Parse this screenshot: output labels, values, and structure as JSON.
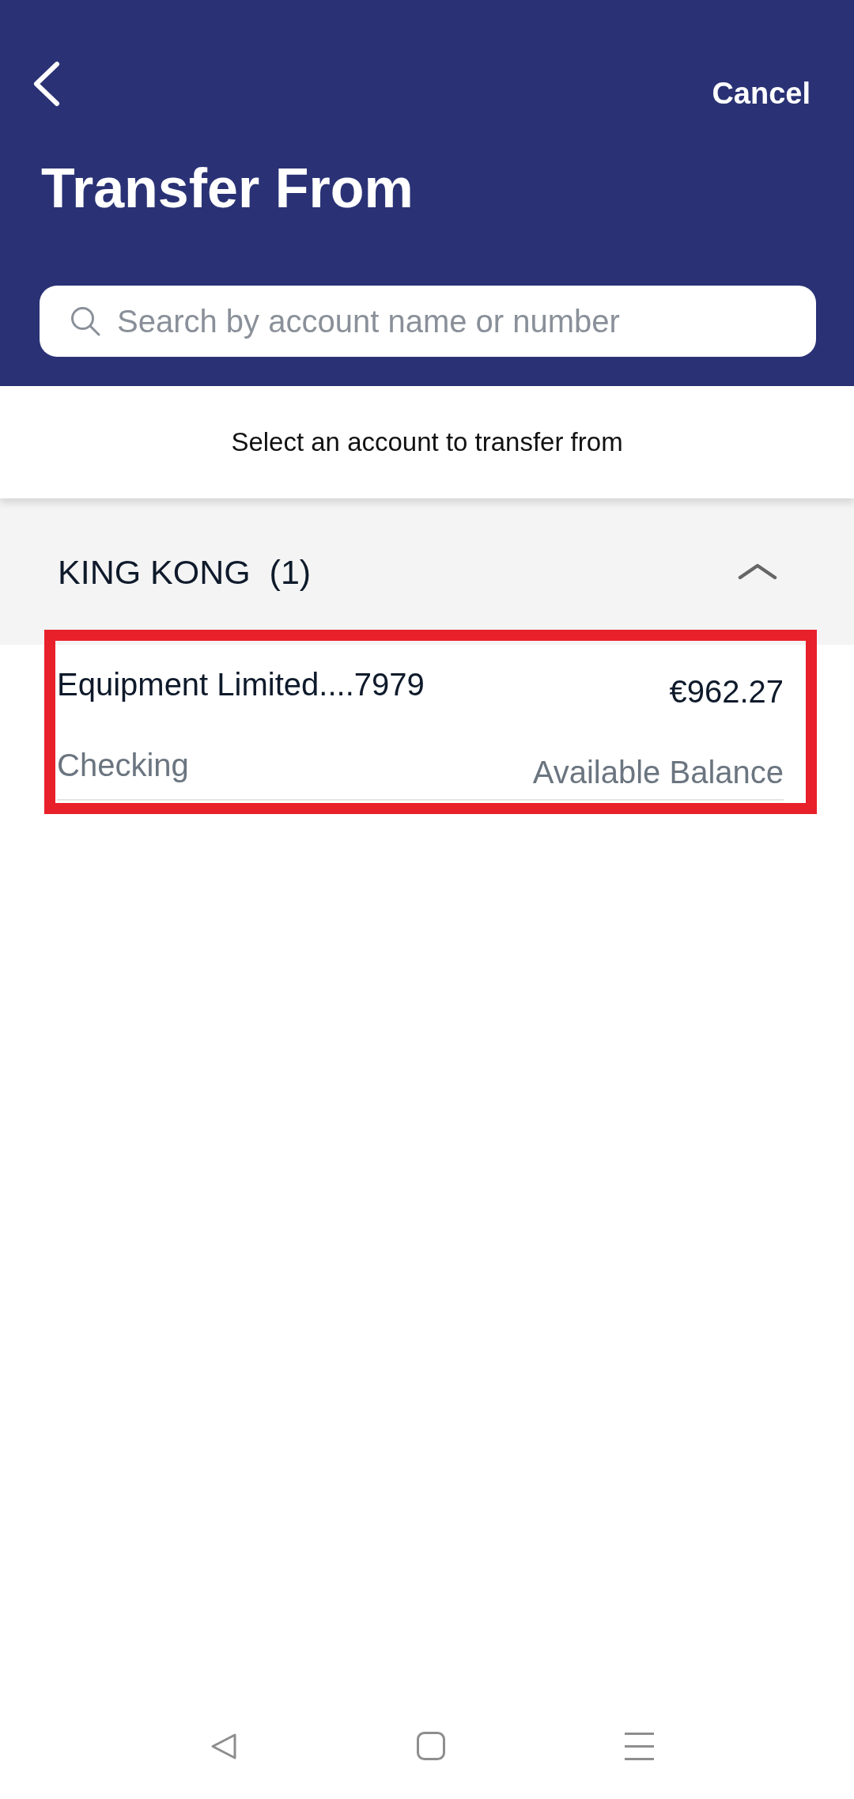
{
  "header": {
    "cancel": "Cancel",
    "title": "Transfer From"
  },
  "search": {
    "placeholder": "Search by account name or number"
  },
  "instruction": "Select an account to transfer from",
  "groups": [
    {
      "title": "KING KONG  (1)",
      "expanded": true,
      "accounts": [
        {
          "name": "Equipment Limited....7979",
          "balance": "€962.27",
          "type": "Checking",
          "balance_label": "Available Balance",
          "highlighted": true
        }
      ]
    }
  ]
}
